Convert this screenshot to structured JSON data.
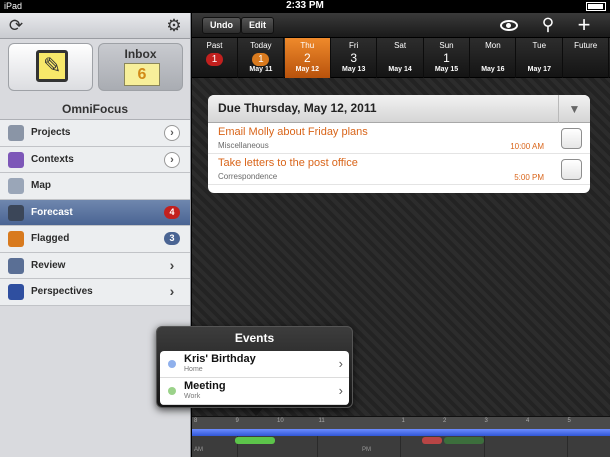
{
  "status_bar": {
    "carrier": "iPad",
    "time": "2:33 PM"
  },
  "sidebar": {
    "inbox_label": "Inbox",
    "inbox_count": "6",
    "app_title": "OmniFocus",
    "items": [
      {
        "label": "Projects",
        "icon": "projects-icon",
        "icon_color": "#8a95a6",
        "accessory": "disclosure"
      },
      {
        "label": "Contexts",
        "icon": "contexts-icon",
        "icon_color": "#7d57b8",
        "accessory": "disclosure"
      },
      {
        "label": "Map",
        "icon": "map-icon",
        "icon_color": "#9aa6b8",
        "accessory": "none"
      },
      {
        "label": "Forecast",
        "icon": "forecast-icon",
        "icon_color": "#3b4658",
        "accessory": "badge",
        "badge": "4",
        "badge_color": "#c2201e"
      },
      {
        "label": "Flagged",
        "icon": "flag-icon",
        "icon_color": "#d87a1e",
        "accessory": "badge",
        "badge": "3",
        "badge_color": "#4a6493"
      },
      {
        "label": "Review",
        "icon": "review-icon",
        "icon_color": "#5a6f95",
        "accessory": "chevron"
      },
      {
        "label": "Perspectives",
        "icon": "perspectives-icon",
        "icon_color": "#2f4fa0",
        "accessory": "chevron"
      }
    ]
  },
  "toolbar": {
    "undo_label": "Undo",
    "edit_label": "Edit"
  },
  "date_strip": [
    {
      "name": "Past",
      "num": "1",
      "date": "",
      "style": "badge-red"
    },
    {
      "name": "Today",
      "num": "1",
      "date": "May 11",
      "style": "badge-orange"
    },
    {
      "name": "Thu",
      "num": "2",
      "date": "May 12",
      "style": "selected"
    },
    {
      "name": "Fri",
      "num": "3",
      "date": "May 13",
      "style": "plain"
    },
    {
      "name": "Sat",
      "num": "",
      "date": "May 14",
      "style": "plain"
    },
    {
      "name": "Sun",
      "num": "1",
      "date": "May 15",
      "style": "plain"
    },
    {
      "name": "Mon",
      "num": "",
      "date": "May 16",
      "style": "plain"
    },
    {
      "name": "Tue",
      "num": "",
      "date": "May 17",
      "style": "plain"
    },
    {
      "name": "Future",
      "num": "",
      "date": "",
      "style": "plain"
    }
  ],
  "due": {
    "title": "Due Thursday, May 12, 2011",
    "tasks": [
      {
        "name": "Email Molly about Friday plans",
        "context": "Miscellaneous",
        "time": "10:00 AM"
      },
      {
        "name": "Take letters to the post office",
        "context": "Correspondence",
        "time": "5:00 PM"
      }
    ]
  },
  "events": {
    "title": "Events",
    "items": [
      {
        "name": "Kris' Birthday",
        "calendar": "Home",
        "color": "#8fb0ec"
      },
      {
        "name": "Meeting",
        "calendar": "Work",
        "color": "#9bd28a"
      }
    ]
  },
  "timeline": {
    "ticks": [
      "8",
      "9",
      "10",
      "11",
      "",
      "1",
      "2",
      "3",
      "4",
      "5"
    ],
    "am_label": "AM",
    "pm_label": "PM",
    "colors": {
      "bar": "#3d63e0",
      "meeting": "#5cc44a",
      "red_block": "#b84545",
      "green_block": "#3c6e3c"
    }
  }
}
